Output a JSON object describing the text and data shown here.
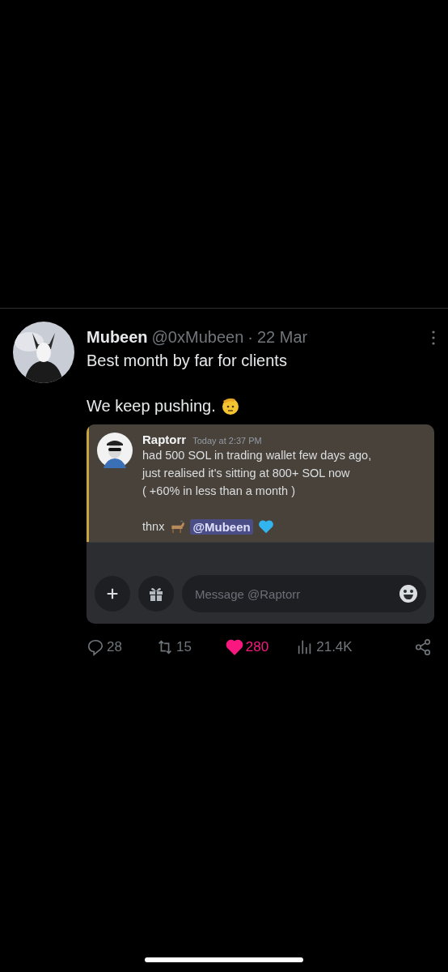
{
  "post": {
    "author": "Mubeen",
    "handle": "@0xMubeen",
    "separator": "·",
    "date": "22 Mar",
    "paragraphs": [
      "Best month by far for clients",
      "We keep pushing."
    ],
    "embed": {
      "author": "Raptorr",
      "time": "Today at 2:37 PM",
      "lines": [
        "had 500 SOL in trading wallet few days ago,",
        "just realised it's sitting at 800+ SOL now",
        "( +60% in less than a month )"
      ],
      "closing": "thnx",
      "mention": "@Mubeen",
      "input_placeholder": "Message @Raptorr"
    },
    "stats": {
      "replies": "28",
      "reposts": "15",
      "likes": "280",
      "liked": true,
      "views": "21.4K"
    }
  }
}
